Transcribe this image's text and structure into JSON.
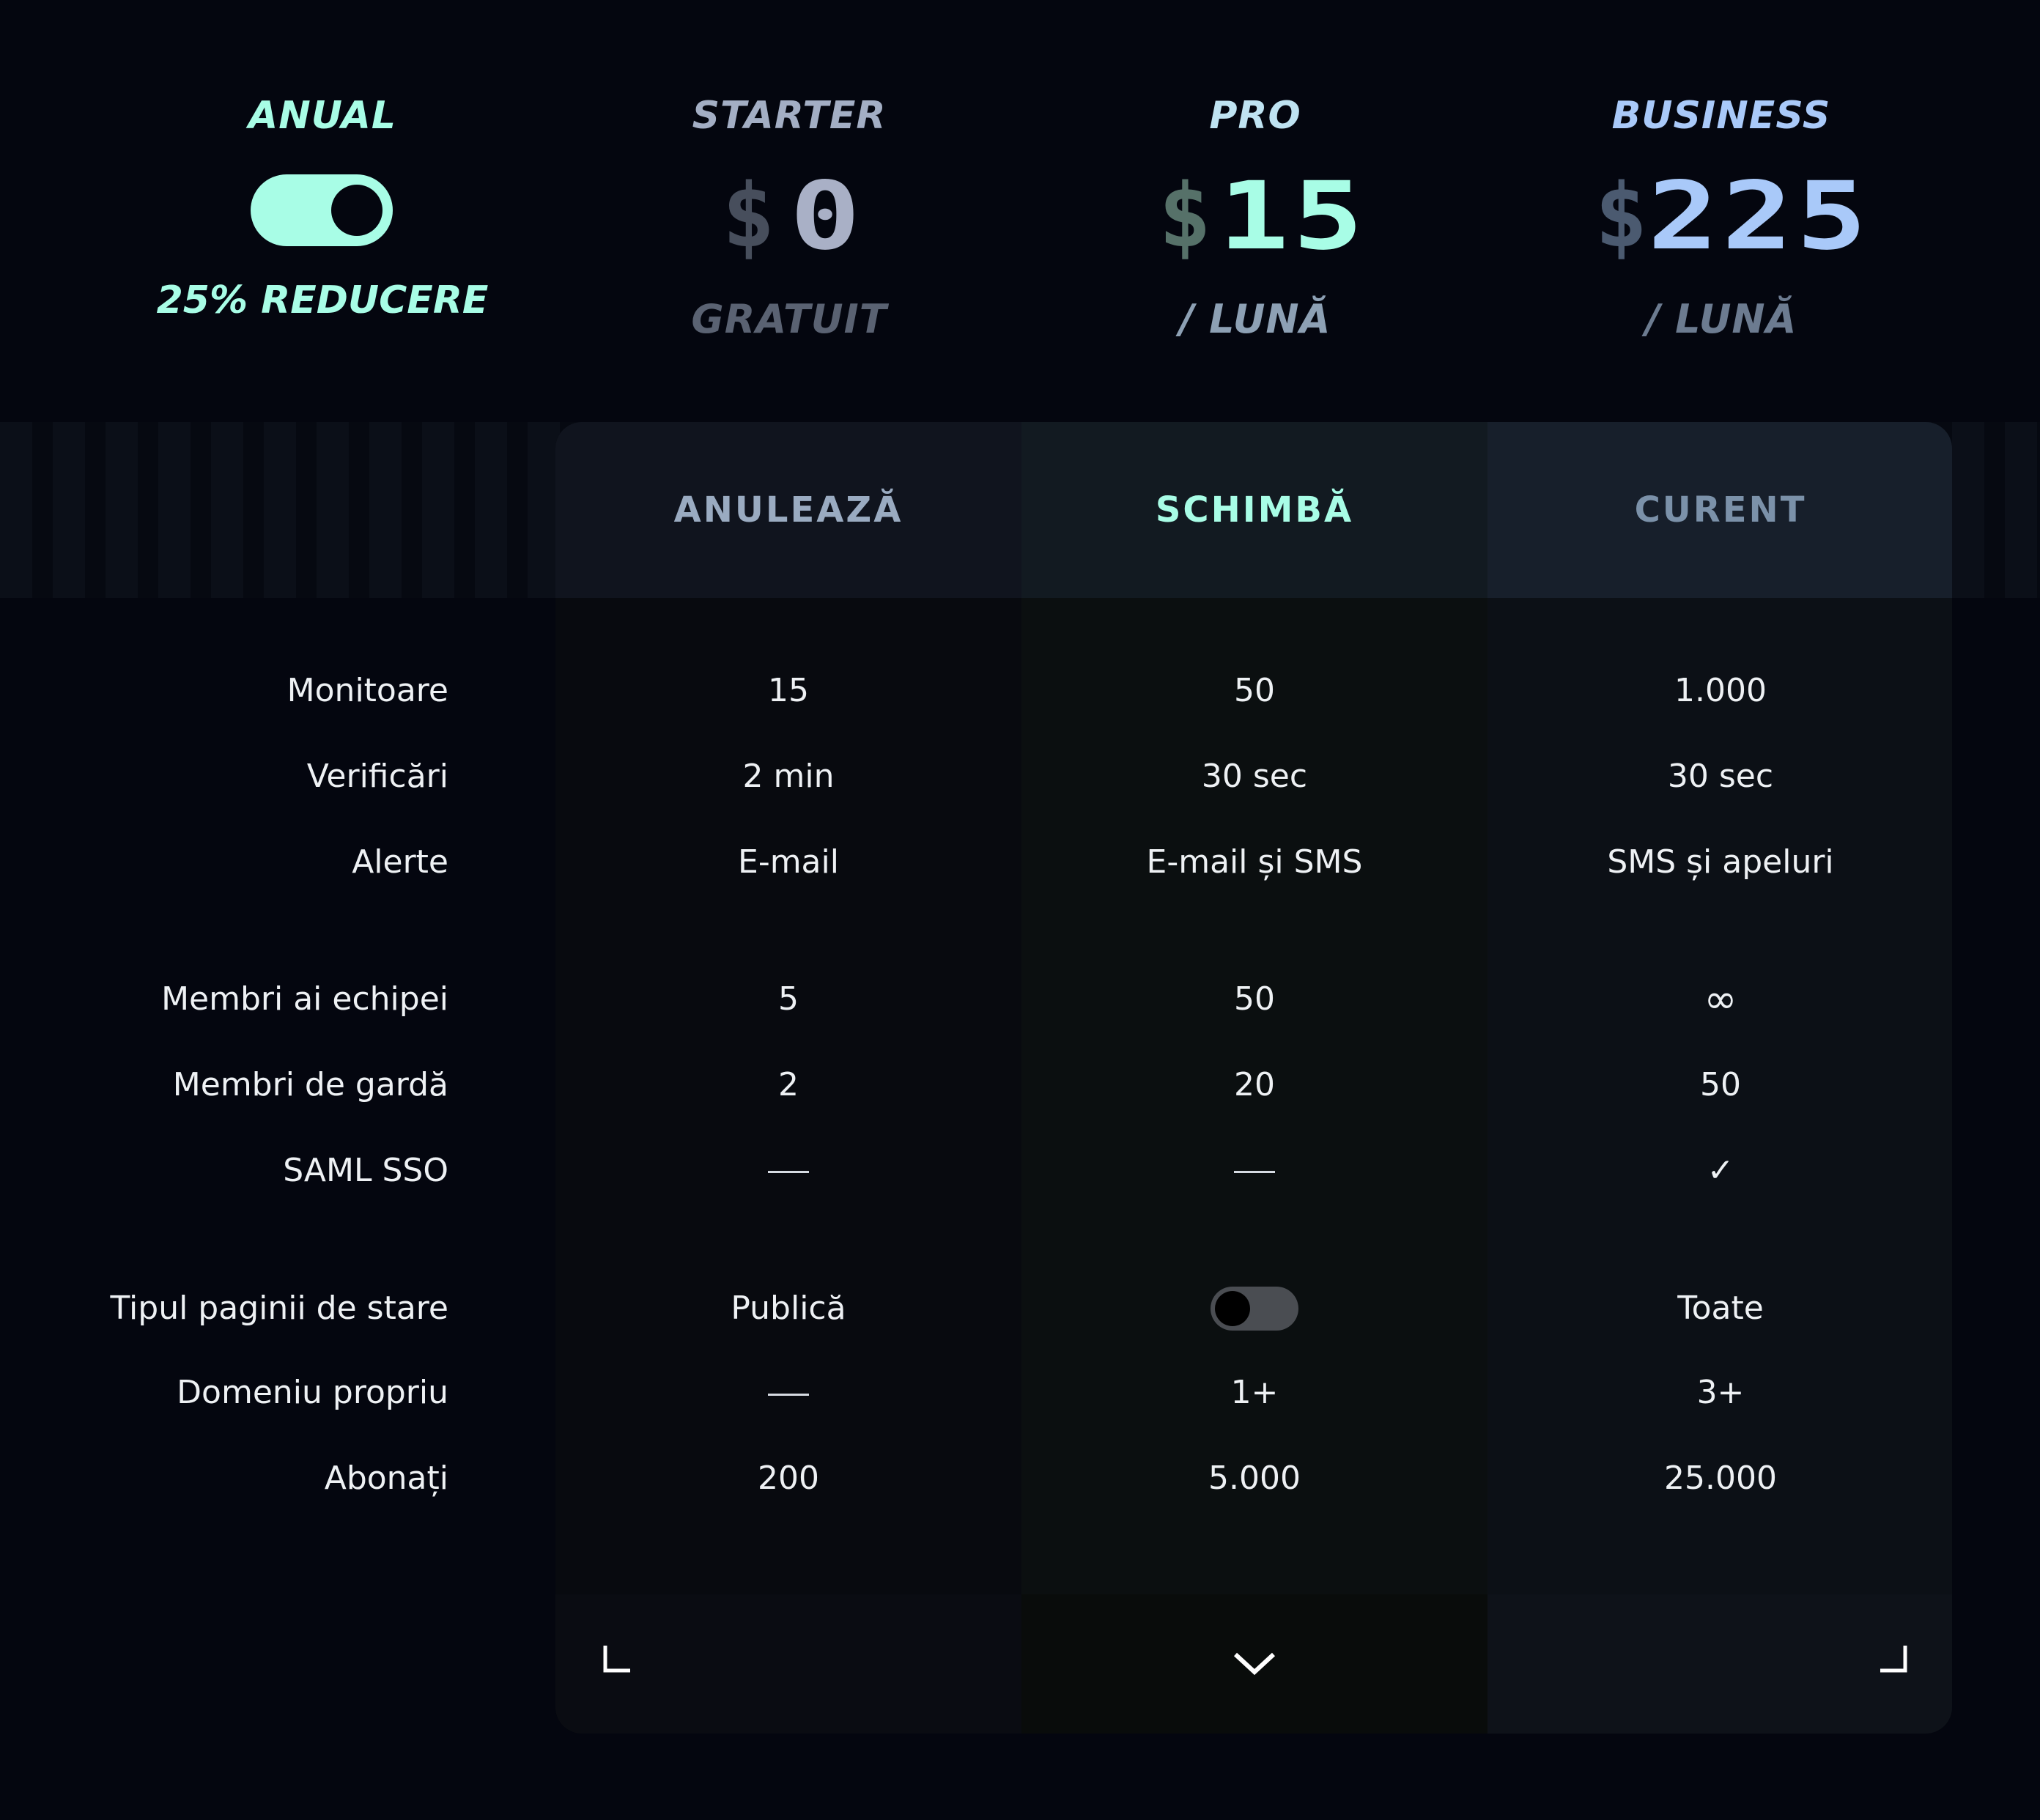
{
  "billing": {
    "title": "ANUAL",
    "toggle_on": true,
    "discount": "25% REDUCERE"
  },
  "plans": [
    {
      "name": "STARTER",
      "currency": "$",
      "amount": "0",
      "period": "GRATUIT",
      "action": "ANULEAZĂ",
      "name_color": "#a3aec4",
      "price_color": "#a9b0c6",
      "period_color": "#5a6272",
      "currency_color": "#474e5c"
    },
    {
      "name": "PRO",
      "currency": "$",
      "amount": "15",
      "period": "/ LUNĂ",
      "action": "SCHIMBĂ",
      "name_color": "#bfe3f2",
      "price_color": "#a8fde6",
      "period_color": "#8da0b4",
      "currency_color": "#567169"
    },
    {
      "name": "BUSINESS",
      "currency": "$",
      "amount": "225",
      "period": "/ LUNĂ",
      "action": "CURENT",
      "name_color": "#a9c9f9",
      "price_color": "#a9c9f9",
      "period_color": "#6c7b90",
      "currency_color": "#4b5a70"
    }
  ],
  "features": {
    "monitoare": {
      "label": "Monitoare",
      "values": [
        "15",
        "50",
        "1.000"
      ]
    },
    "verificari": {
      "label": "Verificări",
      "values": [
        "2 min",
        "30 sec",
        "30 sec"
      ]
    },
    "alerte": {
      "label": "Alerte",
      "values": [
        "E-mail",
        "E-mail și SMS",
        "SMS și apeluri"
      ]
    },
    "membri_echipa": {
      "label": "Membri ai echipei",
      "values": [
        "5",
        "50",
        "∞"
      ]
    },
    "membri_garda": {
      "label": "Membri de gardă",
      "values": [
        "2",
        "20",
        "50"
      ]
    },
    "saml": {
      "label": "SAML SSO",
      "values": [
        "—",
        "—",
        "✓"
      ]
    },
    "tip_pagina": {
      "label": "Tipul paginii de stare",
      "values": [
        "Publică",
        "",
        "Toate"
      ]
    },
    "domeniu": {
      "label": "Domeniu propriu",
      "values": [
        "—",
        "1+",
        "3+"
      ]
    },
    "abonati": {
      "label": "Abonați",
      "values": [
        "200",
        "5.000",
        "25.000"
      ]
    }
  },
  "icons": {
    "status_page_toggle": "toggle-off-icon",
    "footer_left": "corner-bottom-left-icon",
    "footer_center": "chevron-down-icon",
    "footer_right": "corner-bottom-right-icon"
  }
}
